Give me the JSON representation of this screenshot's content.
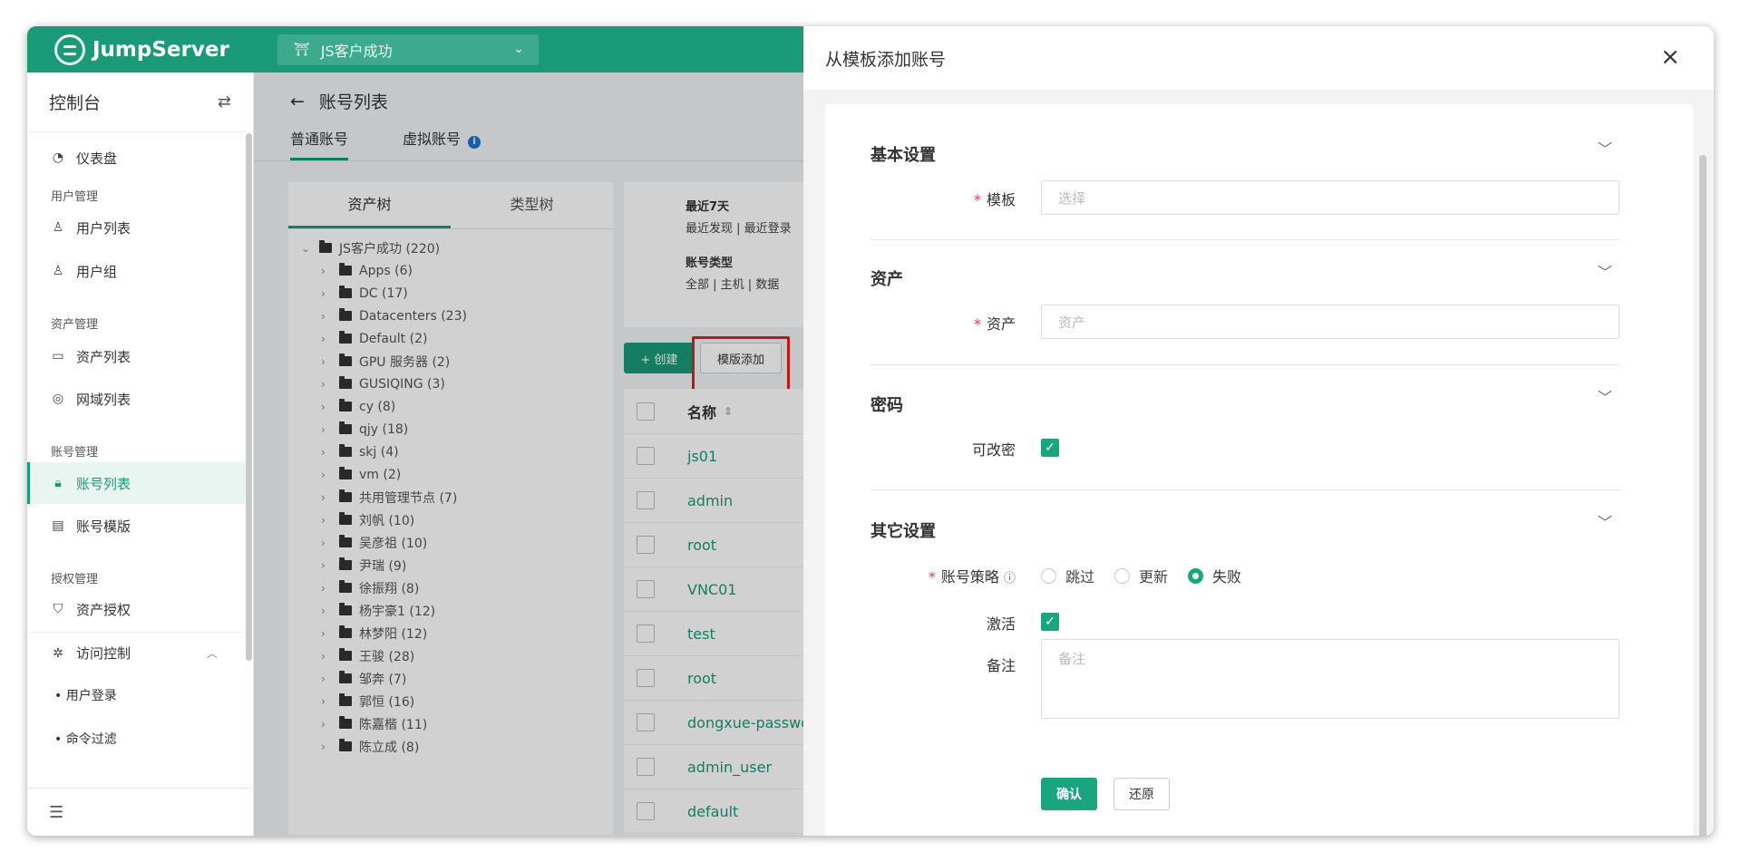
{
  "app": {
    "brand": "JumpServer",
    "org": "JS客户成功"
  },
  "sidebar": {
    "title": "控制台",
    "items": [
      {
        "label": "仪表盘",
        "icon": "dashboard-icon"
      },
      {
        "group": "用户管理"
      },
      {
        "label": "用户列表",
        "icon": "user-icon"
      },
      {
        "label": "用户组",
        "icon": "users-icon"
      },
      {
        "group": "资产管理"
      },
      {
        "label": "资产列表",
        "icon": "monitor-icon"
      },
      {
        "label": "网域列表",
        "icon": "location-icon"
      },
      {
        "group": "账号管理"
      },
      {
        "label": "账号列表",
        "icon": "lock-icon",
        "active": true
      },
      {
        "label": "账号模版",
        "icon": "template-icon"
      },
      {
        "group": "授权管理"
      },
      {
        "label": "资产授权",
        "icon": "shield-icon"
      },
      {
        "label": "访问控制",
        "icon": "access-control-icon"
      },
      {
        "label": "用户登录",
        "sub": true
      },
      {
        "label": "命令过滤",
        "sub": true
      }
    ]
  },
  "page": {
    "title": "账号列表",
    "tabs": [
      "普通账号",
      "虚拟账号"
    ]
  },
  "tree": {
    "tabs": [
      "资产树",
      "类型树"
    ],
    "root": "JS客户成功 (220)",
    "nodes": [
      "Apps (6)",
      "DC (17)",
      "Datacenters (23)",
      "Default (2)",
      "GPU 服务器 (2)",
      "GUSIQING (3)",
      "cy (8)",
      "qjy (18)",
      "skj (4)",
      "vm (2)",
      "共用管理节点 (7)",
      "刘帆 (10)",
      "吴彦祖 (10)",
      "尹瑞 (9)",
      "徐振翔 (8)",
      "杨宇豪1 (12)",
      "林梦阳 (12)",
      "王骏 (28)",
      "邹奔 (7)",
      "郭恒 (16)",
      "陈嘉楷 (11)",
      "陈立成 (8)"
    ]
  },
  "filters": {
    "recent_title": "最近7天",
    "recent_values": "最近发现 | 最近登录",
    "type_title": "账号类型",
    "type_values": "全部 | 主机 | 数据"
  },
  "toolbar": {
    "create": "+ 创建",
    "template_add": "模版添加"
  },
  "table": {
    "header": "名称",
    "rows": [
      "js01",
      "admin",
      "root",
      "VNC01",
      "test",
      "root",
      "dongxue-passwo",
      "admin_user",
      "default"
    ]
  },
  "drawer": {
    "title": "从模板添加账号",
    "sections": {
      "basic": {
        "title": "基本设置",
        "template_label": "模板",
        "template_placeholder": "选择"
      },
      "asset": {
        "title": "资产",
        "asset_label": "资产",
        "asset_placeholder": "资产"
      },
      "password": {
        "title": "密码",
        "changeable_label": "可改密"
      },
      "other": {
        "title": "其它设置",
        "policy_label": "账号策略",
        "policy_options": [
          "跳过",
          "更新",
          "失败"
        ],
        "policy_selected": "失败",
        "active_label": "激活",
        "comment_label": "备注",
        "comment_placeholder": "备注"
      }
    },
    "confirm": "确认",
    "reset": "还原"
  },
  "colors": {
    "brand": "#1a9a78",
    "highlight": "#e02020",
    "link": "#1a9a78"
  }
}
